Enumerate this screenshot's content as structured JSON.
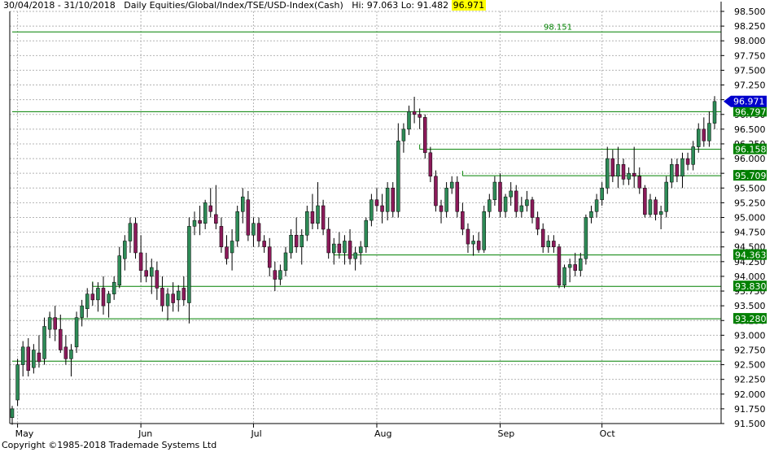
{
  "header": {
    "date_range": "30/04/2018 - 31/10/2018",
    "description": "Daily  Equities/Global/Index/TSE/USD-Index(Cash)",
    "hi_text": "Hi: 97.063",
    "lo_text": "Lo: 91.482",
    "last": "96.971"
  },
  "footer": {
    "copyright": "Copyright ©1985-2018 Trademade Systems Ltd"
  },
  "colors": {
    "grid": "#b4b4b4",
    "level_line": "#008000",
    "level_label_bg": "#008000",
    "level_label_text": "#ffffff",
    "last_badge_bg": "#0000cc",
    "candle_up": "#2e8b57",
    "candle_down": "#8b1a5a"
  },
  "chart_data": {
    "type": "candlestick",
    "title": "Daily  Equities/Global/Index/TSE/USD-Index(Cash)",
    "ylim": [
      91.5,
      98.25
    ],
    "ytick_step": 0.25,
    "yticks": [
      "91.500",
      "91.750",
      "92.000",
      "92.250",
      "92.500",
      "92.750",
      "93.000",
      "93.250",
      "93.500",
      "93.750",
      "94.000",
      "94.250",
      "94.500",
      "94.750",
      "95.000",
      "95.250",
      "95.500",
      "95.750",
      "96.000",
      "96.250",
      "96.500",
      "96.750",
      "97.000",
      "97.250",
      "97.500",
      "97.750",
      "98.000",
      "98.250",
      "98.500"
    ],
    "x_axis_labels": [
      {
        "label": "May",
        "bar": 1
      },
      {
        "label": "Jun",
        "bar": 24
      },
      {
        "label": "Jul",
        "bar": 45
      },
      {
        "label": "Aug",
        "bar": 68
      },
      {
        "label": "Sep",
        "bar": 91
      },
      {
        "label": "Oct",
        "bar": 110
      }
    ],
    "grid": true,
    "levels": [
      {
        "value": 98.151,
        "label": "98.151",
        "label_position": "inline",
        "from_bar": 0
      },
      {
        "value": 96.797,
        "label": "96.797",
        "label_position": "axis",
        "from_bar": 0
      },
      {
        "value": 96.158,
        "label": "96.158",
        "label_position": "axis",
        "from_bar": 76
      },
      {
        "value": 95.709,
        "label": "95.709",
        "label_position": "axis",
        "from_bar": 84
      },
      {
        "value": 94.363,
        "label": "94.363",
        "label_position": "axis",
        "from_bar": 60
      },
      {
        "value": 93.83,
        "label": "93.830",
        "label_position": "axis",
        "from_bar": 15
      },
      {
        "value": 93.28,
        "label": "93.280",
        "label_position": "axis",
        "from_bar": 7
      },
      {
        "value": 92.56,
        "label": "",
        "label_position": "none",
        "from_bar": 0
      }
    ],
    "last_price": {
      "value": 96.971,
      "label": "96.971"
    },
    "candles": [
      {
        "o": 91.6,
        "h": 91.8,
        "l": 91.48,
        "c": 91.75
      },
      {
        "o": 91.9,
        "h": 92.6,
        "l": 91.8,
        "c": 92.5
      },
      {
        "o": 92.5,
        "h": 92.9,
        "l": 92.3,
        "c": 92.8
      },
      {
        "o": 92.8,
        "h": 92.95,
        "l": 92.3,
        "c": 92.4
      },
      {
        "o": 92.45,
        "h": 92.85,
        "l": 92.35,
        "c": 92.75
      },
      {
        "o": 92.7,
        "h": 93.0,
        "l": 92.45,
        "c": 92.55
      },
      {
        "o": 92.6,
        "h": 93.3,
        "l": 92.5,
        "c": 93.15
      },
      {
        "o": 93.1,
        "h": 93.4,
        "l": 92.95,
        "c": 93.3
      },
      {
        "o": 93.3,
        "h": 93.5,
        "l": 92.9,
        "c": 93.1
      },
      {
        "o": 93.1,
        "h": 93.35,
        "l": 92.7,
        "c": 92.75
      },
      {
        "o": 92.8,
        "h": 93.0,
        "l": 92.5,
        "c": 92.6
      },
      {
        "o": 92.6,
        "h": 92.85,
        "l": 92.3,
        "c": 92.75
      },
      {
        "o": 92.8,
        "h": 93.4,
        "l": 92.7,
        "c": 93.3
      },
      {
        "o": 93.3,
        "h": 93.6,
        "l": 93.15,
        "c": 93.5
      },
      {
        "o": 93.45,
        "h": 93.8,
        "l": 93.3,
        "c": 93.7
      },
      {
        "o": 93.7,
        "h": 93.9,
        "l": 93.5,
        "c": 93.6
      },
      {
        "o": 93.6,
        "h": 93.9,
        "l": 93.4,
        "c": 93.8
      },
      {
        "o": 93.8,
        "h": 94.0,
        "l": 93.35,
        "c": 93.5
      },
      {
        "o": 93.55,
        "h": 93.75,
        "l": 93.3,
        "c": 93.7
      },
      {
        "o": 93.7,
        "h": 94.0,
        "l": 93.6,
        "c": 93.9
      },
      {
        "o": 93.85,
        "h": 94.5,
        "l": 93.8,
        "c": 94.35
      },
      {
        "o": 94.3,
        "h": 94.7,
        "l": 94.1,
        "c": 94.6
      },
      {
        "o": 94.6,
        "h": 95.0,
        "l": 94.4,
        "c": 94.9
      },
      {
        "o": 94.9,
        "h": 95.0,
        "l": 94.3,
        "c": 94.4
      },
      {
        "o": 94.4,
        "h": 94.7,
        "l": 93.9,
        "c": 94.1
      },
      {
        "o": 94.1,
        "h": 94.4,
        "l": 93.9,
        "c": 94.0
      },
      {
        "o": 94.0,
        "h": 94.3,
        "l": 93.7,
        "c": 94.15
      },
      {
        "o": 94.1,
        "h": 94.25,
        "l": 93.6,
        "c": 93.8
      },
      {
        "o": 93.8,
        "h": 94.0,
        "l": 93.4,
        "c": 93.5
      },
      {
        "o": 93.5,
        "h": 93.8,
        "l": 93.25,
        "c": 93.7
      },
      {
        "o": 93.7,
        "h": 93.9,
        "l": 93.4,
        "c": 93.55
      },
      {
        "o": 93.6,
        "h": 93.85,
        "l": 93.4,
        "c": 93.75
      },
      {
        "o": 93.8,
        "h": 94.0,
        "l": 93.5,
        "c": 93.6
      },
      {
        "o": 93.55,
        "h": 95.0,
        "l": 93.2,
        "c": 94.85
      },
      {
        "o": 94.85,
        "h": 95.1,
        "l": 94.7,
        "c": 94.95
      },
      {
        "o": 94.95,
        "h": 95.2,
        "l": 94.7,
        "c": 94.9
      },
      {
        "o": 94.9,
        "h": 95.3,
        "l": 94.8,
        "c": 95.25
      },
      {
        "o": 95.2,
        "h": 95.5,
        "l": 95.0,
        "c": 95.1
      },
      {
        "o": 95.05,
        "h": 95.55,
        "l": 94.8,
        "c": 94.9
      },
      {
        "o": 94.85,
        "h": 95.0,
        "l": 94.4,
        "c": 94.5
      },
      {
        "o": 94.5,
        "h": 94.7,
        "l": 94.2,
        "c": 94.3
      },
      {
        "o": 94.4,
        "h": 94.8,
        "l": 94.1,
        "c": 94.6
      },
      {
        "o": 94.6,
        "h": 95.2,
        "l": 94.5,
        "c": 95.1
      },
      {
        "o": 95.1,
        "h": 95.5,
        "l": 94.9,
        "c": 95.35
      },
      {
        "o": 95.3,
        "h": 95.45,
        "l": 94.6,
        "c": 94.7
      },
      {
        "o": 94.7,
        "h": 95.0,
        "l": 94.5,
        "c": 94.9
      },
      {
        "o": 94.9,
        "h": 95.0,
        "l": 94.5,
        "c": 94.6
      },
      {
        "o": 94.6,
        "h": 94.7,
        "l": 94.4,
        "c": 94.5
      },
      {
        "o": 94.5,
        "h": 94.65,
        "l": 94.0,
        "c": 94.15
      },
      {
        "o": 94.1,
        "h": 94.25,
        "l": 93.75,
        "c": 93.95
      },
      {
        "o": 93.95,
        "h": 94.2,
        "l": 93.85,
        "c": 94.1
      },
      {
        "o": 94.1,
        "h": 94.5,
        "l": 94.0,
        "c": 94.4
      },
      {
        "o": 94.4,
        "h": 94.8,
        "l": 94.3,
        "c": 94.7
      },
      {
        "o": 94.7,
        "h": 95.0,
        "l": 94.4,
        "c": 94.5
      },
      {
        "o": 94.5,
        "h": 94.8,
        "l": 94.2,
        "c": 94.7
      },
      {
        "o": 94.7,
        "h": 95.2,
        "l": 94.6,
        "c": 95.1
      },
      {
        "o": 95.1,
        "h": 95.4,
        "l": 94.8,
        "c": 94.9
      },
      {
        "o": 94.9,
        "h": 95.6,
        "l": 94.8,
        "c": 95.2
      },
      {
        "o": 95.2,
        "h": 95.3,
        "l": 94.7,
        "c": 94.8
      },
      {
        "o": 94.8,
        "h": 95.0,
        "l": 94.3,
        "c": 94.4
      },
      {
        "o": 94.4,
        "h": 94.65,
        "l": 94.2,
        "c": 94.55
      },
      {
        "o": 94.55,
        "h": 94.75,
        "l": 94.3,
        "c": 94.4
      },
      {
        "o": 94.4,
        "h": 94.7,
        "l": 94.2,
        "c": 94.6
      },
      {
        "o": 94.6,
        "h": 94.8,
        "l": 94.2,
        "c": 94.3
      },
      {
        "o": 94.3,
        "h": 94.5,
        "l": 94.1,
        "c": 94.4
      },
      {
        "o": 94.4,
        "h": 94.6,
        "l": 94.2,
        "c": 94.5
      },
      {
        "o": 94.5,
        "h": 95.0,
        "l": 94.4,
        "c": 94.95
      },
      {
        "o": 94.95,
        "h": 95.4,
        "l": 94.85,
        "c": 95.3
      },
      {
        "o": 95.3,
        "h": 95.5,
        "l": 95.1,
        "c": 95.2
      },
      {
        "o": 95.2,
        "h": 95.4,
        "l": 94.9,
        "c": 95.1
      },
      {
        "o": 95.1,
        "h": 95.6,
        "l": 94.95,
        "c": 95.5
      },
      {
        "o": 95.5,
        "h": 95.6,
        "l": 95.0,
        "c": 95.1
      },
      {
        "o": 95.1,
        "h": 96.6,
        "l": 95.0,
        "c": 96.3
      },
      {
        "o": 96.3,
        "h": 96.6,
        "l": 96.1,
        "c": 96.5
      },
      {
        "o": 96.5,
        "h": 96.9,
        "l": 96.4,
        "c": 96.8
      },
      {
        "o": 96.8,
        "h": 97.05,
        "l": 96.6,
        "c": 96.75
      },
      {
        "o": 96.75,
        "h": 96.85,
        "l": 96.5,
        "c": 96.7
      },
      {
        "o": 96.7,
        "h": 96.75,
        "l": 96.0,
        "c": 96.1
      },
      {
        "o": 96.1,
        "h": 96.2,
        "l": 95.6,
        "c": 95.7
      },
      {
        "o": 95.7,
        "h": 95.8,
        "l": 95.1,
        "c": 95.2
      },
      {
        "o": 95.2,
        "h": 95.3,
        "l": 94.9,
        "c": 95.1
      },
      {
        "o": 95.1,
        "h": 95.6,
        "l": 95.0,
        "c": 95.5
      },
      {
        "o": 95.5,
        "h": 95.7,
        "l": 95.4,
        "c": 95.6
      },
      {
        "o": 95.6,
        "h": 95.7,
        "l": 95.0,
        "c": 95.1
      },
      {
        "o": 95.1,
        "h": 95.25,
        "l": 94.7,
        "c": 94.8
      },
      {
        "o": 94.8,
        "h": 94.9,
        "l": 94.4,
        "c": 94.55
      },
      {
        "o": 94.55,
        "h": 94.7,
        "l": 94.35,
        "c": 94.6
      },
      {
        "o": 94.6,
        "h": 94.75,
        "l": 94.4,
        "c": 94.45
      },
      {
        "o": 94.45,
        "h": 95.2,
        "l": 94.4,
        "c": 95.1
      },
      {
        "o": 95.1,
        "h": 95.4,
        "l": 95.0,
        "c": 95.3
      },
      {
        "o": 95.3,
        "h": 95.7,
        "l": 95.2,
        "c": 95.6
      },
      {
        "o": 95.6,
        "h": 95.75,
        "l": 95.0,
        "c": 95.1
      },
      {
        "o": 95.1,
        "h": 95.4,
        "l": 95.0,
        "c": 95.35
      },
      {
        "o": 95.35,
        "h": 95.6,
        "l": 95.2,
        "c": 95.45
      },
      {
        "o": 95.45,
        "h": 95.55,
        "l": 95.0,
        "c": 95.1
      },
      {
        "o": 95.1,
        "h": 95.35,
        "l": 95.0,
        "c": 95.2
      },
      {
        "o": 95.2,
        "h": 95.45,
        "l": 95.1,
        "c": 95.3
      },
      {
        "o": 95.3,
        "h": 95.35,
        "l": 94.9,
        "c": 95.0
      },
      {
        "o": 95.0,
        "h": 95.1,
        "l": 94.7,
        "c": 94.8
      },
      {
        "o": 94.8,
        "h": 94.9,
        "l": 94.4,
        "c": 94.5
      },
      {
        "o": 94.5,
        "h": 94.7,
        "l": 94.4,
        "c": 94.6
      },
      {
        "o": 94.6,
        "h": 94.7,
        "l": 94.4,
        "c": 94.5
      },
      {
        "o": 94.5,
        "h": 94.55,
        "l": 93.8,
        "c": 93.85
      },
      {
        "o": 93.85,
        "h": 94.2,
        "l": 93.8,
        "c": 94.15
      },
      {
        "o": 94.15,
        "h": 94.3,
        "l": 93.9,
        "c": 94.2
      },
      {
        "o": 94.2,
        "h": 94.4,
        "l": 94.0,
        "c": 94.1
      },
      {
        "o": 94.1,
        "h": 94.4,
        "l": 94.0,
        "c": 94.3
      },
      {
        "o": 94.3,
        "h": 95.05,
        "l": 94.2,
        "c": 95.0
      },
      {
        "o": 95.0,
        "h": 95.2,
        "l": 94.9,
        "c": 95.1
      },
      {
        "o": 95.1,
        "h": 95.4,
        "l": 95.0,
        "c": 95.3
      },
      {
        "o": 95.3,
        "h": 95.6,
        "l": 95.2,
        "c": 95.5
      },
      {
        "o": 95.5,
        "h": 96.2,
        "l": 95.4,
        "c": 96.0
      },
      {
        "o": 96.0,
        "h": 96.15,
        "l": 95.6,
        "c": 95.7
      },
      {
        "o": 95.7,
        "h": 96.2,
        "l": 95.5,
        "c": 95.9
      },
      {
        "o": 95.9,
        "h": 96.0,
        "l": 95.55,
        "c": 95.65
      },
      {
        "o": 95.65,
        "h": 95.85,
        "l": 95.55,
        "c": 95.75
      },
      {
        "o": 95.75,
        "h": 96.2,
        "l": 95.5,
        "c": 95.7
      },
      {
        "o": 95.7,
        "h": 95.85,
        "l": 95.4,
        "c": 95.5
      },
      {
        "o": 95.5,
        "h": 95.55,
        "l": 95.0,
        "c": 95.05
      },
      {
        "o": 95.05,
        "h": 95.4,
        "l": 95.0,
        "c": 95.3
      },
      {
        "o": 95.3,
        "h": 95.35,
        "l": 94.95,
        "c": 95.05
      },
      {
        "o": 95.05,
        "h": 95.2,
        "l": 94.8,
        "c": 95.1
      },
      {
        "o": 95.1,
        "h": 95.7,
        "l": 95.0,
        "c": 95.6
      },
      {
        "o": 95.6,
        "h": 96.0,
        "l": 95.5,
        "c": 95.9
      },
      {
        "o": 95.9,
        "h": 96.0,
        "l": 95.6,
        "c": 95.7
      },
      {
        "o": 95.7,
        "h": 96.1,
        "l": 95.5,
        "c": 96.0
      },
      {
        "o": 96.0,
        "h": 96.1,
        "l": 95.8,
        "c": 95.9
      },
      {
        "o": 95.9,
        "h": 96.3,
        "l": 95.8,
        "c": 96.2
      },
      {
        "o": 96.2,
        "h": 96.6,
        "l": 96.1,
        "c": 96.5
      },
      {
        "o": 96.5,
        "h": 96.7,
        "l": 96.2,
        "c": 96.3
      },
      {
        "o": 96.3,
        "h": 96.8,
        "l": 96.2,
        "c": 96.6
      },
      {
        "o": 96.6,
        "h": 97.06,
        "l": 96.5,
        "c": 96.97
      }
    ]
  }
}
